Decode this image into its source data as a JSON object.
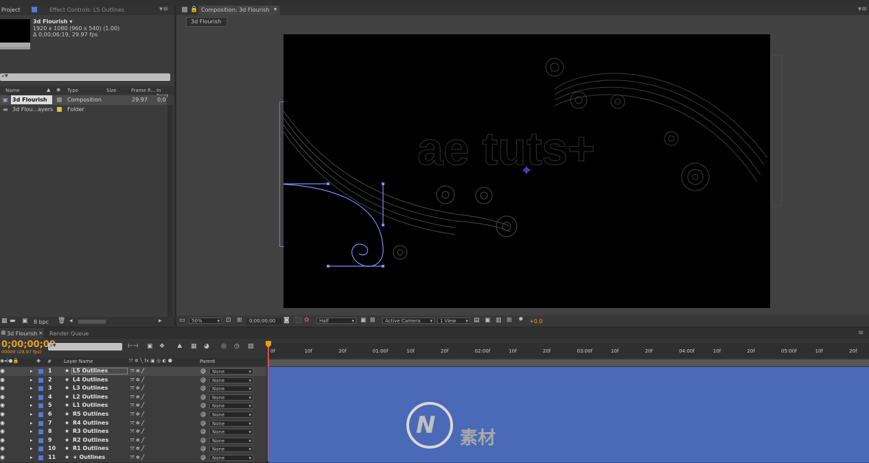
{
  "top_tabs": {
    "project": "Project",
    "effect_controls": "Effect Controls: L5 Outlines",
    "composition": "Composition: 3d Flourish",
    "comp_crumb": "3d Flourish"
  },
  "project": {
    "selected_name": "3d Flourish ▾",
    "dimensions": "1920 x 1080  (960 x 540) (1.00)",
    "duration": "Δ 0;00;06;19, 29.97 fps",
    "columns": [
      "Name",
      "Type",
      "Size",
      "Frame R...",
      "In Point"
    ],
    "items": [
      {
        "name": "3d Flourish",
        "type": "Composition",
        "fps": "29.97",
        "in": "0;0",
        "swatch": "#8a8a8a"
      },
      {
        "name": "3d Flou...ayers",
        "type": "Folder",
        "fps": "",
        "in": "",
        "swatch": "#e0c040"
      }
    ],
    "bpc": "8 bpc"
  },
  "viewer": {
    "zoom": "50%",
    "timecode": "0;00;00;00",
    "resolution": "Half",
    "camera": "Active Camera",
    "views": "1 View",
    "exposure": "+0.0",
    "logo_text": "ae tuts+"
  },
  "timeline": {
    "tab": "3d Flourish",
    "render_queue": "Render Queue",
    "timecode": "0;00;00;00",
    "frame_info": "00000 (29.97 fps)",
    "col_layer_name": "Layer Name",
    "col_parent": "Parent",
    "col_hash": "#",
    "ruler": [
      "0f",
      "10f",
      "20f",
      "01:00f",
      "10f",
      "20f",
      "02:00f",
      "10f",
      "20f",
      "03:00f",
      "10f",
      "20f",
      "04:00f",
      "10f",
      "20f",
      "05:00f",
      "10f",
      "20f"
    ],
    "layers": [
      {
        "num": "1",
        "name": "L5 Outlines",
        "parent": "None"
      },
      {
        "num": "2",
        "name": "L4 Outlines",
        "parent": "None"
      },
      {
        "num": "3",
        "name": "L3 Outlines",
        "parent": "None"
      },
      {
        "num": "4",
        "name": "L2 Outlines",
        "parent": "None"
      },
      {
        "num": "5",
        "name": "L1 Outlines",
        "parent": "None"
      },
      {
        "num": "6",
        "name": "R5 Outlines",
        "parent": "None"
      },
      {
        "num": "7",
        "name": "R4 Outlines",
        "parent": "None"
      },
      {
        "num": "8",
        "name": "R3 Outlines",
        "parent": "None"
      },
      {
        "num": "9",
        "name": "R2 Outlines",
        "parent": "None"
      },
      {
        "num": "10",
        "name": "R1 Outlines",
        "parent": "None"
      },
      {
        "num": "11",
        "name": "+ Outlines",
        "parent": "None"
      }
    ]
  },
  "watermark": "素材",
  "colors": {
    "accent": "#4a69b6",
    "label": "#5577dd",
    "orange": "#e8a020"
  }
}
